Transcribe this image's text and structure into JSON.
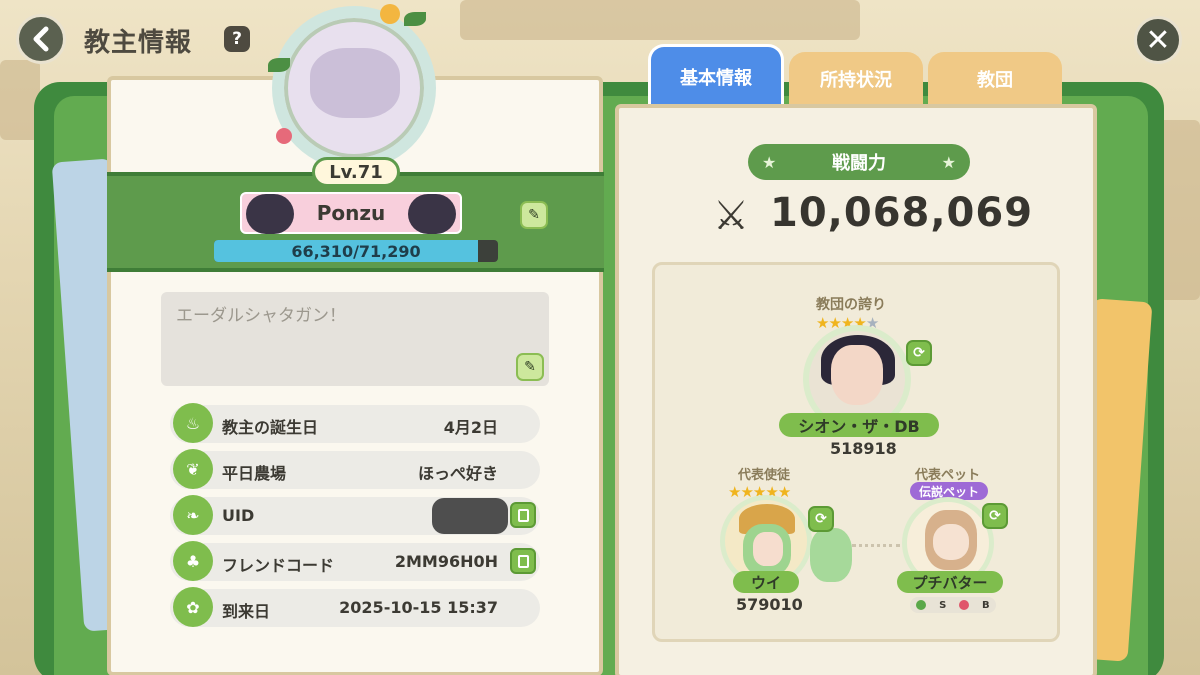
{
  "header": {
    "title": "教主情報",
    "help_glyph": "?",
    "close_glyph": "✕"
  },
  "profile": {
    "level": "Lv.71",
    "name": "Ponzu",
    "exp": "66,310/71,290",
    "exp_progress": 0.93,
    "bio": "エーダルシャタガン！"
  },
  "info_rows": [
    {
      "label": "教主の誕生日",
      "value": "4月2日",
      "icon": "cake-icon"
    },
    {
      "label": "平日農場",
      "value": "ほっぺ好き",
      "icon": "radish-icon"
    },
    {
      "label": "UID",
      "value": "",
      "icon": "leaf-icon"
    },
    {
      "label": "フレンドコード",
      "value": "2MM96H0H",
      "icon": "clover-icon"
    },
    {
      "label": "到来日",
      "value": "2025-10-15 15:37",
      "icon": "sprout-icon"
    }
  ],
  "tabs": [
    {
      "label": "基本情報",
      "active": true
    },
    {
      "label": "所持状況",
      "active": false
    },
    {
      "label": "教団",
      "active": false
    }
  ],
  "power": {
    "label": "戦闘力",
    "value": "10,068,069",
    "icon": "crossed-swords-icon"
  },
  "pride": {
    "label": "教団の誇り",
    "stars_filled": 4,
    "stars_total": 5,
    "name": "シオン・ザ・DB",
    "number": "518918"
  },
  "representative": {
    "label": "代表使徒",
    "stars_filled": 5,
    "stars_total": 5,
    "name": "ウイ",
    "number": "579010"
  },
  "pet": {
    "label": "代表ペット",
    "badge": "伝説ペット",
    "name": "プチバター",
    "tags": [
      "S",
      "B"
    ]
  },
  "colors": {
    "book_green": "#3f8a3e",
    "active_tab": "#4e8de8",
    "inactive_tab": "#f0c986",
    "exp_fill": "#55c2df",
    "pet_badge": "#9e6ad6"
  }
}
